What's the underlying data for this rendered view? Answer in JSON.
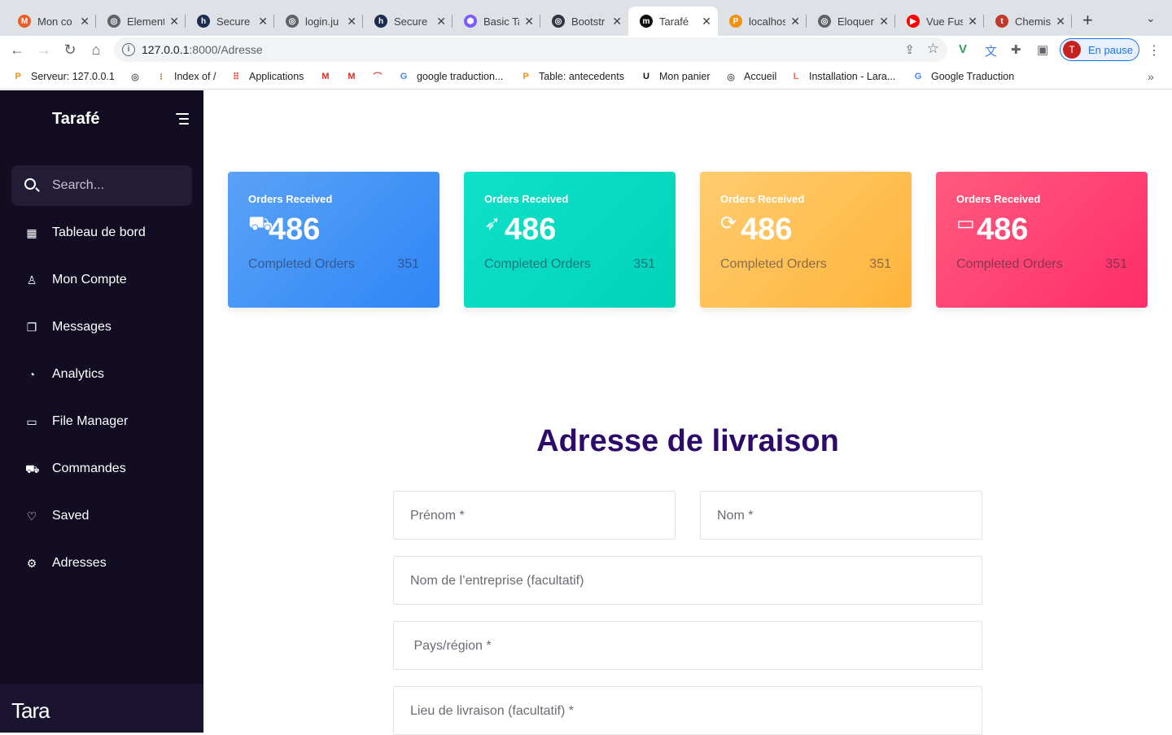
{
  "browser": {
    "tabs": [
      {
        "title": "Mon co",
        "fav": "M",
        "color": "#e85d2a"
      },
      {
        "title": "Element",
        "fav": "◎",
        "color": "#5f6368"
      },
      {
        "title": "Secure",
        "fav": "h",
        "color": "#1d2b4f"
      },
      {
        "title": "login.ju",
        "fav": "◎",
        "color": "#5f6368"
      },
      {
        "title": "Secure",
        "fav": "h",
        "color": "#1d2b4f"
      },
      {
        "title": "Basic Ta",
        "fav": "⬢",
        "color": "#7b5cff"
      },
      {
        "title": "Bootstr",
        "fav": "◎",
        "color": "#334"
      },
      {
        "title": "Tarafé",
        "fav": "m",
        "color": "#111"
      },
      {
        "title": "localhos",
        "fav": "P",
        "color": "#f29111"
      },
      {
        "title": "Eloquen",
        "fav": "◎",
        "color": "#5f6368"
      },
      {
        "title": "Vue Fus",
        "fav": "▶",
        "color": "#ff0000"
      },
      {
        "title": "Chemis",
        "fav": "t",
        "color": "#c0392b"
      }
    ],
    "active_tab_index": 7,
    "url_host": "127.0.0.1",
    "url_path": ":8000/Adresse",
    "profile_initial": "T",
    "profile_label": "En pause",
    "bookmarks": [
      {
        "label": "Serveur: 127.0.0.1",
        "icon": "phpmyadmin-icon"
      },
      {
        "label": "",
        "icon": "globe-icon"
      },
      {
        "label": "Index of /",
        "icon": "index-icon"
      },
      {
        "label": "Applications",
        "icon": "apps-grid-icon"
      },
      {
        "label": "",
        "icon": "gmail-icon"
      },
      {
        "label": "",
        "icon": "gmail-icon"
      },
      {
        "label": "",
        "icon": "rainbow-icon"
      },
      {
        "label": "google traduction...",
        "icon": "google-icon"
      },
      {
        "label": "Table: antecedents",
        "icon": "phpmyadmin-icon"
      },
      {
        "label": "Mon panier",
        "icon": "panier-icon"
      },
      {
        "label": "Accueil",
        "icon": "globe-icon"
      },
      {
        "label": "Installation - Lara...",
        "icon": "laravel-icon"
      },
      {
        "label": "Google Traduction",
        "icon": "translate-icon"
      }
    ]
  },
  "sidebar": {
    "brand": "Tarafé",
    "search_placeholder": "Search...",
    "items": [
      {
        "label": "Tableau de bord",
        "icon": "dashboard-grid-icon"
      },
      {
        "label": "Mon Compte",
        "icon": "user-icon"
      },
      {
        "label": "Messages",
        "icon": "chat-icon"
      },
      {
        "label": "Analytics",
        "icon": "pie-chart-icon"
      },
      {
        "label": "File Manager",
        "icon": "folder-icon"
      },
      {
        "label": "Commandes",
        "icon": "cart-icon"
      },
      {
        "label": "Saved",
        "icon": "heart-icon"
      },
      {
        "label": "Adresses",
        "icon": "gear-icon"
      }
    ],
    "footer_logo": "Tara"
  },
  "cards": [
    {
      "title": "Orders Received",
      "value": "486",
      "subtitle": "Completed Orders",
      "count": "351",
      "icon": "cart-plus-icon",
      "gradient": [
        "#5aa2f7",
        "#2f86f6"
      ]
    },
    {
      "title": "Orders Received",
      "value": "486",
      "subtitle": "Completed Orders",
      "count": "351",
      "icon": "rocket-icon",
      "gradient": [
        "#0fe1c9",
        "#00d3b7"
      ]
    },
    {
      "title": "Orders Received",
      "value": "486",
      "subtitle": "Completed Orders",
      "count": "351",
      "icon": "refresh-icon",
      "gradient": [
        "#ffcc70",
        "#ffb43a"
      ]
    },
    {
      "title": "Orders Received",
      "value": "486",
      "subtitle": "Completed Orders",
      "count": "351",
      "icon": "credit-card-icon",
      "gradient": [
        "#ff5a7e",
        "#ff2d6a"
      ]
    }
  ],
  "form": {
    "heading": "Adresse de livraison",
    "first_name_placeholder": "Prénom *",
    "last_name_placeholder": "Nom *",
    "company_placeholder": "Nom de l’entreprise (facultatif)",
    "country_placeholder": " Pays/région *",
    "delivery_placeholder": "Lieu de livraison (facultatif) *"
  }
}
